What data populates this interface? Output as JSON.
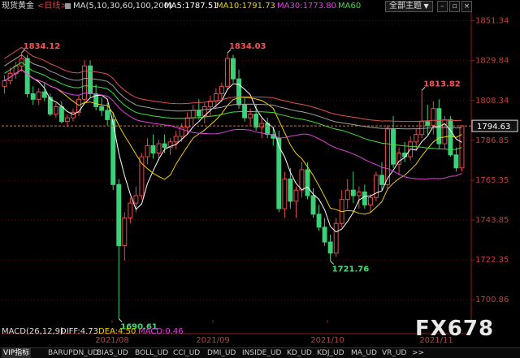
{
  "header": {
    "symbol": "现货黄金",
    "period": "<日线>",
    "ma_label": "MA(5,10,30,60,100,200)",
    "ma5": "MA5:1787.51",
    "ma10": "MA10:1791.73",
    "ma30": "MA30:1773.80",
    "ma60": "MA60",
    "button_label": "全部主题"
  },
  "colors": {
    "bg": "#000000",
    "up": "#e84a4a",
    "down": "#3bd178",
    "ma5": "#ffffff",
    "ma10": "#f0d000",
    "ma30": "#e040e0",
    "ma60": "#40e040",
    "ma100": "#a0a0a0",
    "ma200": "#e05050",
    "axis_text": "#c04040"
  },
  "chart_data": {
    "type": "candlestick",
    "y_ticks": [
      "1851.34",
      "1829.84",
      "1808.34",
      "1786.85",
      "1765.35",
      "1743.85",
      "1722.35",
      "1700.86"
    ],
    "y_range": [
      1690,
      1856
    ],
    "x_labels": [
      "2021/08",
      "2021/09",
      "2021/10",
      "2021/11"
    ],
    "current_price": "1794.63",
    "annotations": [
      "1834.12",
      "1834.03",
      "1813.82",
      "1721.76",
      "1690.61"
    ],
    "candles": [
      [
        1816,
        1822,
        1812,
        1819
      ],
      [
        1819,
        1826,
        1817,
        1823
      ],
      [
        1823,
        1829,
        1820,
        1827
      ],
      [
        1827,
        1834.12,
        1824,
        1831
      ],
      [
        1831,
        1833,
        1810,
        1812
      ],
      [
        1812,
        1816,
        1806,
        1809
      ],
      [
        1809,
        1815,
        1806,
        1813
      ],
      [
        1813,
        1818,
        1808,
        1810
      ],
      [
        1810,
        1812,
        1800,
        1801
      ],
      [
        1801,
        1807,
        1799,
        1805
      ],
      [
        1805,
        1808,
        1796,
        1797
      ],
      [
        1797,
        1801,
        1794,
        1799
      ],
      [
        1799,
        1804,
        1797,
        1802
      ],
      [
        1802,
        1811,
        1800,
        1809
      ],
      [
        1809,
        1830,
        1807,
        1827
      ],
      [
        1827,
        1830,
        1810,
        1812
      ],
      [
        1812,
        1817,
        1803,
        1805
      ],
      [
        1805,
        1810,
        1800,
        1803
      ],
      [
        1803,
        1807,
        1795,
        1798
      ],
      [
        1798,
        1802,
        1760,
        1763
      ],
      [
        1763,
        1766,
        1690.61,
        1730
      ],
      [
        1730,
        1748,
        1722,
        1745
      ],
      [
        1745,
        1756,
        1742,
        1753
      ],
      [
        1753,
        1762,
        1748,
        1757
      ],
      [
        1757,
        1780,
        1755,
        1778
      ],
      [
        1778,
        1788,
        1774,
        1784
      ],
      [
        1784,
        1790,
        1777,
        1780
      ],
      [
        1780,
        1787,
        1776,
        1785
      ],
      [
        1785,
        1790,
        1780,
        1783
      ],
      [
        1783,
        1788,
        1779,
        1786
      ],
      [
        1786,
        1792,
        1782,
        1789
      ],
      [
        1789,
        1796,
        1786,
        1794
      ],
      [
        1794,
        1802,
        1790,
        1799
      ],
      [
        1799,
        1806,
        1795,
        1803
      ],
      [
        1803,
        1809,
        1798,
        1800
      ],
      [
        1800,
        1807,
        1796,
        1805
      ],
      [
        1805,
        1811,
        1800,
        1808
      ],
      [
        1808,
        1815,
        1804,
        1812
      ],
      [
        1812,
        1818,
        1808,
        1816
      ],
      [
        1816,
        1834.03,
        1814,
        1831
      ],
      [
        1831,
        1833,
        1818,
        1820
      ],
      [
        1820,
        1825,
        1804,
        1806
      ],
      [
        1806,
        1810,
        1797,
        1799
      ],
      [
        1799,
        1804,
        1795,
        1801
      ],
      [
        1801,
        1806,
        1792,
        1794
      ],
      [
        1794,
        1799,
        1788,
        1796
      ],
      [
        1796,
        1799,
        1788,
        1790
      ],
      [
        1790,
        1794,
        1784,
        1788
      ],
      [
        1788,
        1792,
        1748,
        1750
      ],
      [
        1750,
        1770,
        1745,
        1766
      ],
      [
        1766,
        1772,
        1750,
        1754
      ],
      [
        1754,
        1762,
        1745,
        1760
      ],
      [
        1760,
        1775,
        1756,
        1771
      ],
      [
        1771,
        1775,
        1755,
        1757
      ],
      [
        1757,
        1761,
        1745,
        1747
      ],
      [
        1747,
        1752,
        1738,
        1740
      ],
      [
        1740,
        1745,
        1730,
        1732
      ],
      [
        1732,
        1736,
        1721.76,
        1726
      ],
      [
        1726,
        1745,
        1724,
        1742
      ],
      [
        1742,
        1760,
        1740,
        1755
      ],
      [
        1755,
        1766,
        1750,
        1760
      ],
      [
        1760,
        1770,
        1753,
        1757
      ],
      [
        1757,
        1762,
        1750,
        1759
      ],
      [
        1759,
        1763,
        1750,
        1752
      ],
      [
        1752,
        1758,
        1748,
        1756
      ],
      [
        1756,
        1770,
        1754,
        1768
      ],
      [
        1768,
        1775,
        1760,
        1763
      ],
      [
        1763,
        1795,
        1761,
        1793
      ],
      [
        1793,
        1800,
        1772,
        1774
      ],
      [
        1774,
        1783,
        1768,
        1780
      ],
      [
        1780,
        1786,
        1775,
        1778
      ],
      [
        1778,
        1789,
        1776,
        1786
      ],
      [
        1786,
        1793,
        1782,
        1790
      ],
      [
        1790,
        1813.82,
        1788,
        1797
      ],
      [
        1797,
        1806,
        1790,
        1795
      ],
      [
        1795,
        1808,
        1790,
        1804
      ],
      [
        1804,
        1809,
        1782,
        1785
      ],
      [
        1785,
        1800,
        1782,
        1798
      ],
      [
        1798,
        1800,
        1778,
        1779
      ],
      [
        1779,
        1783,
        1770,
        1772
      ],
      [
        1772,
        1795,
        1770,
        1794.63
      ]
    ]
  },
  "macd_bar": {
    "label": "MACD(26,12,9)",
    "diff": "DIFF:4.73",
    "dea": "DEA:4.50",
    "macd": "MACD:0.46"
  },
  "tabs": [
    "VIP指标",
    "BARUPDN_UD",
    "BIAS_UD",
    "BOLL_UD",
    "CCI_UD",
    "DMI_UD",
    "INSIDE_UD",
    "KD_UD",
    "KDJ_UD",
    "MA_UD",
    "VR_UD",
    ">>"
  ],
  "watermark": "FX678"
}
